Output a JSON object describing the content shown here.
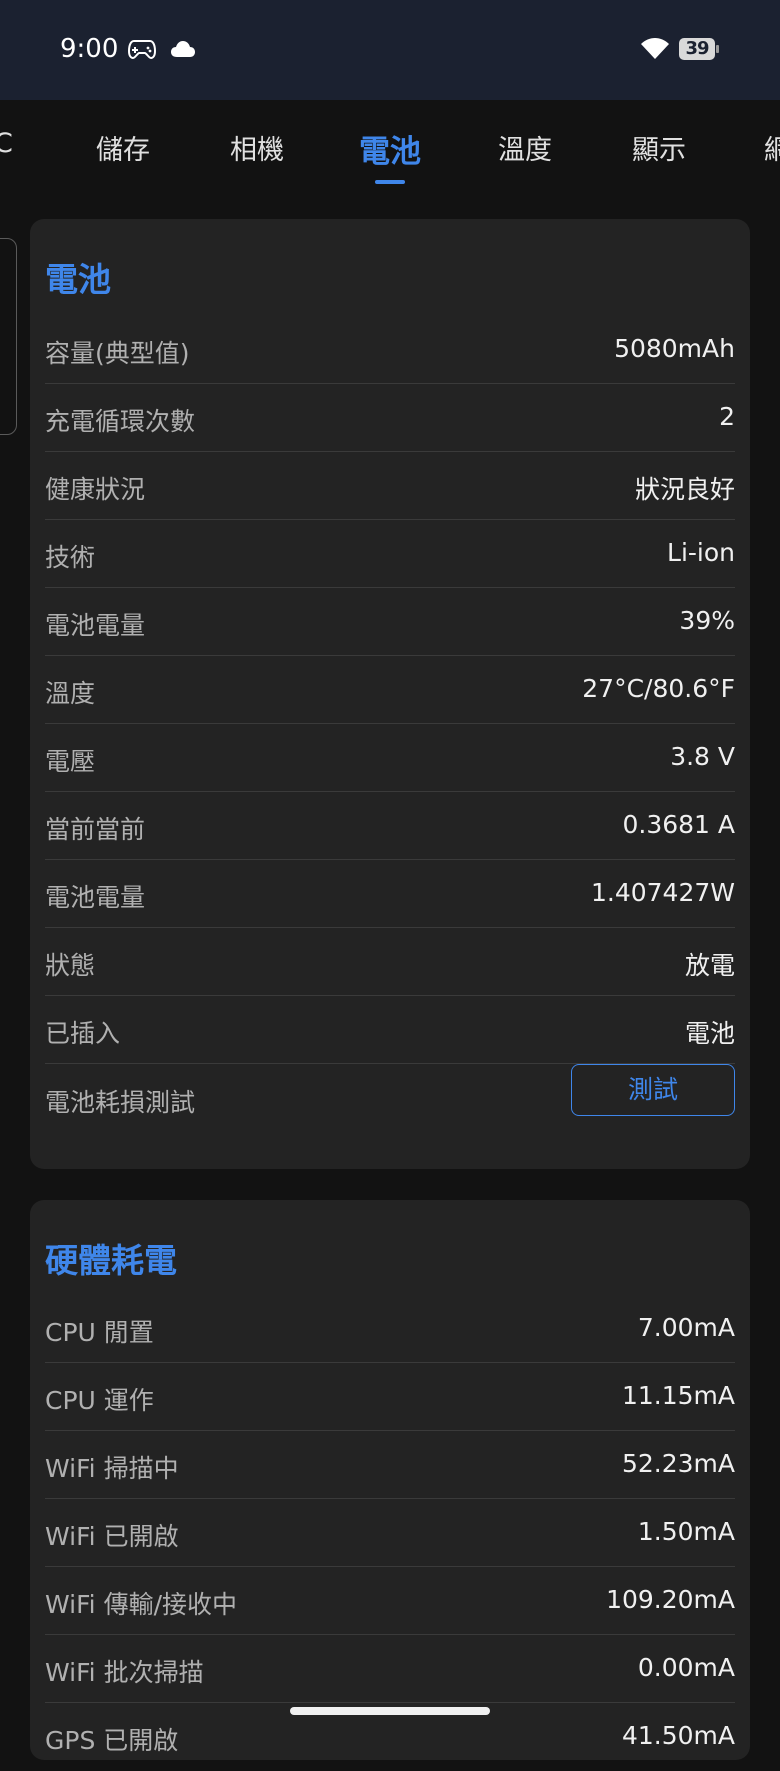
{
  "status_bar": {
    "time": "9:00",
    "battery_level": "39",
    "icons": [
      "gamepad-icon",
      "cloud-icon",
      "wifi-icon",
      "battery-icon"
    ]
  },
  "tabs": [
    {
      "label": "C"
    },
    {
      "label": "儲存"
    },
    {
      "label": "相機"
    },
    {
      "label": "電池",
      "active": true
    },
    {
      "label": "溫度"
    },
    {
      "label": "顯示"
    },
    {
      "label": "網"
    }
  ],
  "battery_card": {
    "title": "電池",
    "rows": [
      {
        "label": "容量(典型值)",
        "value": "5080mAh"
      },
      {
        "label": "充電循環次數",
        "value": "2"
      },
      {
        "label": "健康狀況",
        "value": "狀況良好"
      },
      {
        "label": "技術",
        "value": "Li-ion"
      },
      {
        "label": "電池電量",
        "value": "39%"
      },
      {
        "label": "溫度",
        "value": "27°C/80.6°F"
      },
      {
        "label": "電壓",
        "value": "3.8 V"
      },
      {
        "label": "當前當前",
        "value": "0.3681 A"
      },
      {
        "label": "電池電量",
        "value": "1.407427W"
      },
      {
        "label": "狀態",
        "value": "放電"
      },
      {
        "label": "已插入",
        "value": "電池"
      }
    ],
    "test_row": {
      "label": "電池耗損測試",
      "button": "測試"
    }
  },
  "hardware_card": {
    "title": "硬體耗電",
    "rows": [
      {
        "label": "CPU 閒置",
        "value": "7.00mA"
      },
      {
        "label": "CPU 運作",
        "value": "11.15mA"
      },
      {
        "label": "WiFi 掃描中",
        "value": "52.23mA"
      },
      {
        "label": "WiFi 已開啟",
        "value": "1.50mA"
      },
      {
        "label": "WiFi 傳輸/接收中",
        "value": "109.20mA"
      },
      {
        "label": "WiFi 批次掃描",
        "value": "0.00mA"
      },
      {
        "label": "GPS 已開啟",
        "value": "41.50mA"
      }
    ]
  },
  "colors": {
    "accent": "#3f86ea",
    "background": "#121212",
    "card": "#232323",
    "status_bar": "#1b2130"
  }
}
